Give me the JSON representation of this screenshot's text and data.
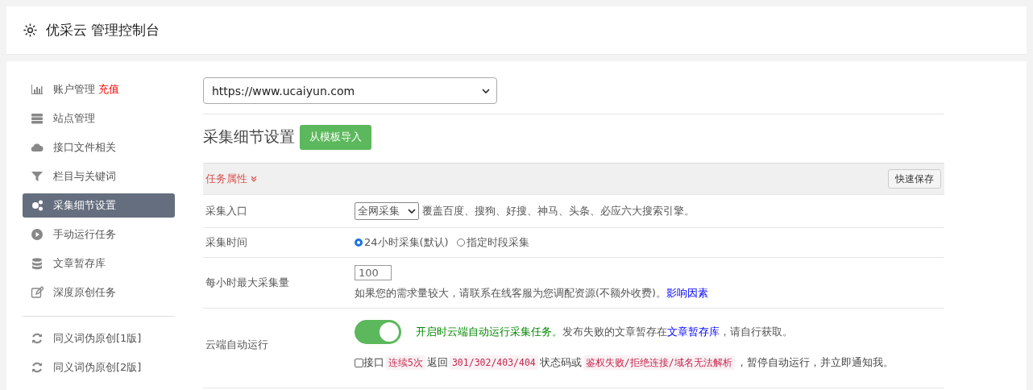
{
  "header": {
    "title": "优采云 管理控制台"
  },
  "sidebar": {
    "items": [
      {
        "label": "账户管理",
        "badge": "充值",
        "selected": false
      },
      {
        "label": "站点管理",
        "selected": false
      },
      {
        "label": "接口文件相关",
        "selected": false
      },
      {
        "label": "栏目与关键词",
        "selected": false
      },
      {
        "label": "采集细节设置",
        "selected": true
      },
      {
        "label": "手动运行任务",
        "selected": false
      },
      {
        "label": "文章暂存库",
        "selected": false
      },
      {
        "label": "深度原创任务",
        "selected": false
      },
      {
        "kind": "divider"
      },
      {
        "label": "同义词伪原创[1版]",
        "selected": false
      },
      {
        "label": "同义词伪原创[2版]",
        "selected": false
      }
    ]
  },
  "site_select": {
    "value": "https://www.ucaiyun.com"
  },
  "section": {
    "title": "采集细节设置",
    "button": "从模板导入"
  },
  "panel": {
    "heading": "任务属性",
    "save_button": "快速保存"
  },
  "entry_row": {
    "label": "采集入口",
    "select": "全网采集",
    "note": "覆盖百度、搜狗、好搜、神马、头条、必应六大搜索引擎。"
  },
  "time_row": {
    "label": "采集时间",
    "options": [
      {
        "label": "24小时采集(默认)",
        "selected": true
      },
      {
        "label": "指定时段采集",
        "selected": false
      }
    ]
  },
  "max_row": {
    "label": "每小时最大采集量",
    "value": "100",
    "note": "如果您的需求量较大，请联系在线客服为您调配资源(不额外收费)。",
    "link": "影响因素"
  },
  "cloud_row": {
    "label": "云端自动运行",
    "on": true,
    "status": "开启时云端自动运行采集任务。",
    "text": "发布失败的文章暂存在",
    "link": "文章暂存库",
    "text_end": "，请自行获取。",
    "notify": {
      "checked": false,
      "parts": [
        {
          "kind": "text",
          "text": "接口"
        },
        {
          "kind": "code",
          "text": "连续5次"
        },
        {
          "kind": "text",
          "text": "返回"
        },
        {
          "kind": "code",
          "text": "301/302/403/404"
        },
        {
          "kind": "text",
          "text": "状态码或"
        },
        {
          "kind": "code",
          "text": "鉴权失败/拒绝连接/域名无法解析"
        },
        {
          "kind": "text",
          "text": "，暂停自动运行，并立即通知我。"
        }
      ]
    }
  }
}
